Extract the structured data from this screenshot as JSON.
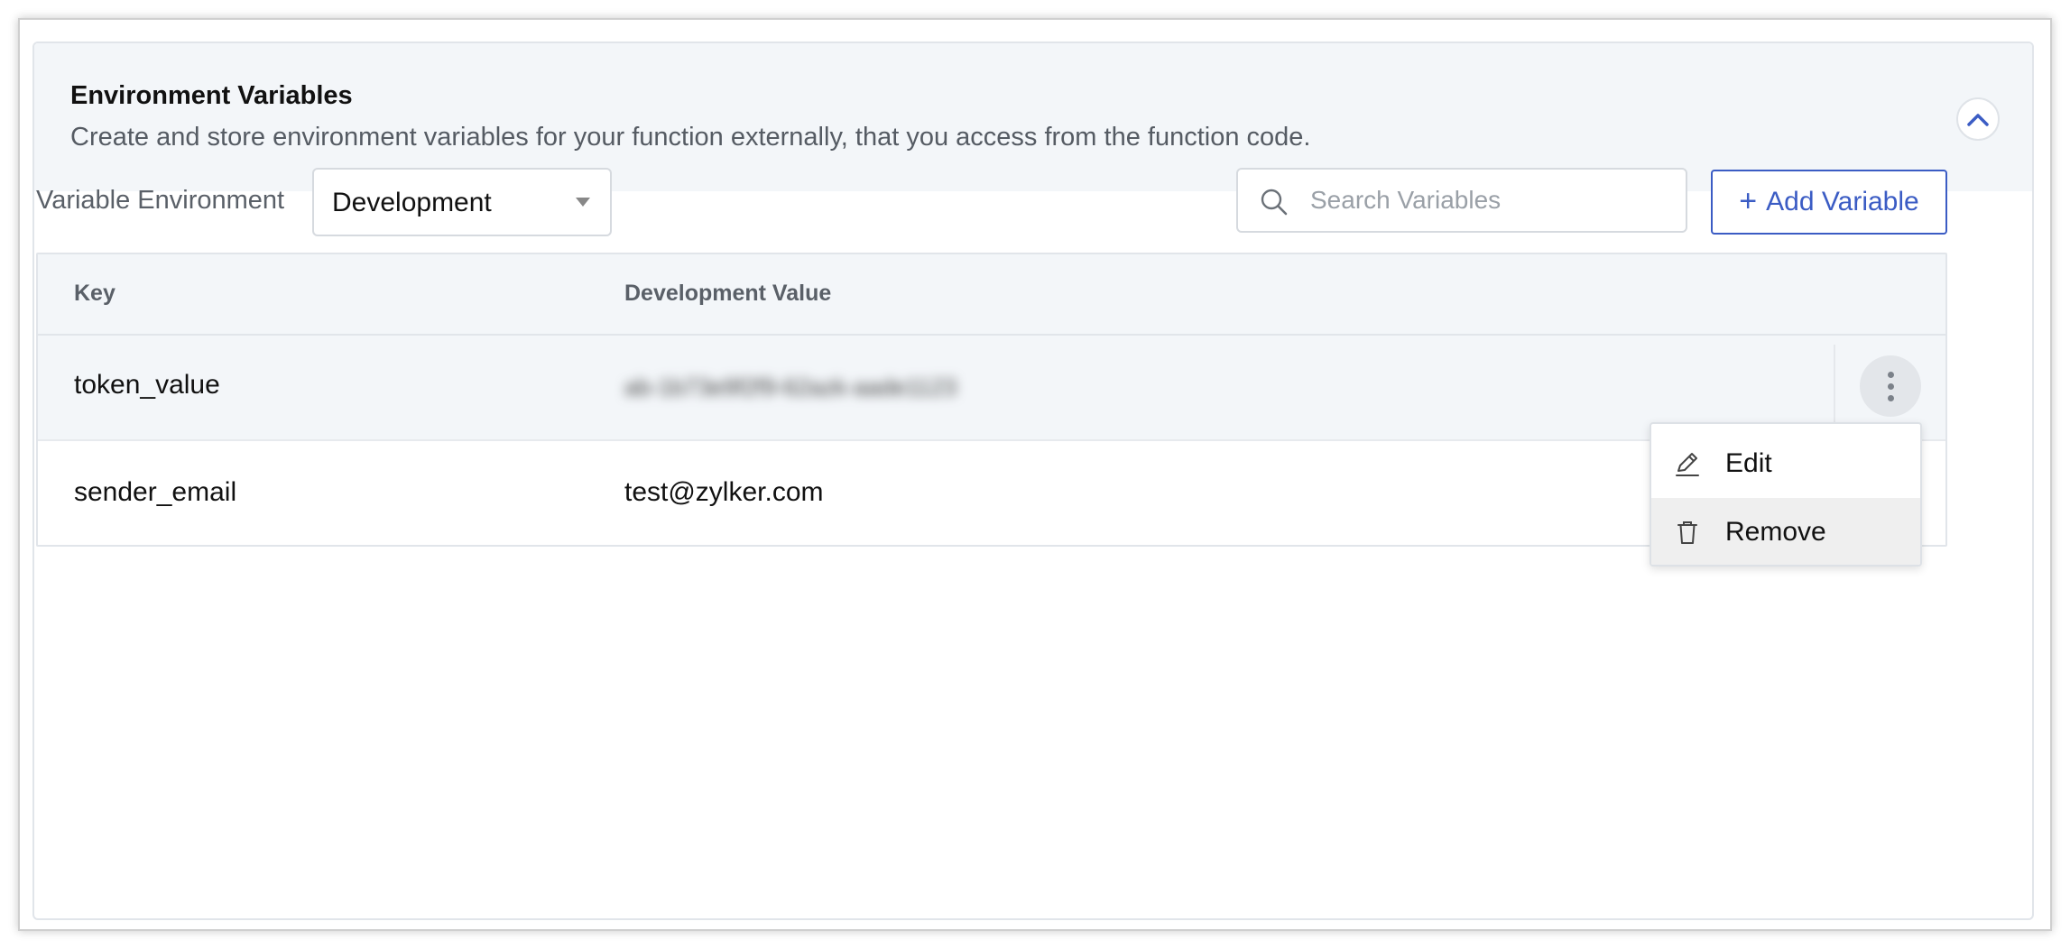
{
  "header": {
    "title": "Environment Variables",
    "subtitle": "Create and store environment variables for your function externally, that you access from the function code.",
    "collapse_icon": "chevron-up-icon"
  },
  "toolbar": {
    "env_label": "Variable Environment",
    "env_selected": "Development",
    "search_placeholder": "Search Variables",
    "add_button_label": "Add Variable",
    "add_icon": "plus-icon"
  },
  "table": {
    "columns": [
      "Key",
      "Development Value"
    ],
    "rows": [
      {
        "key": "token_value",
        "value": "ab-1b73e9f2f9-62azk-aade1123"
      },
      {
        "key": "sender_email",
        "value": "test@zylker.com"
      }
    ]
  },
  "row_menu": {
    "items": [
      {
        "label": "Edit",
        "icon": "pencil-icon"
      },
      {
        "label": "Remove",
        "icon": "trash-icon"
      }
    ]
  },
  "colors": {
    "accent": "#3b5cc4",
    "header_bg": "#f3f6f9",
    "border": "#e1e5ea"
  }
}
